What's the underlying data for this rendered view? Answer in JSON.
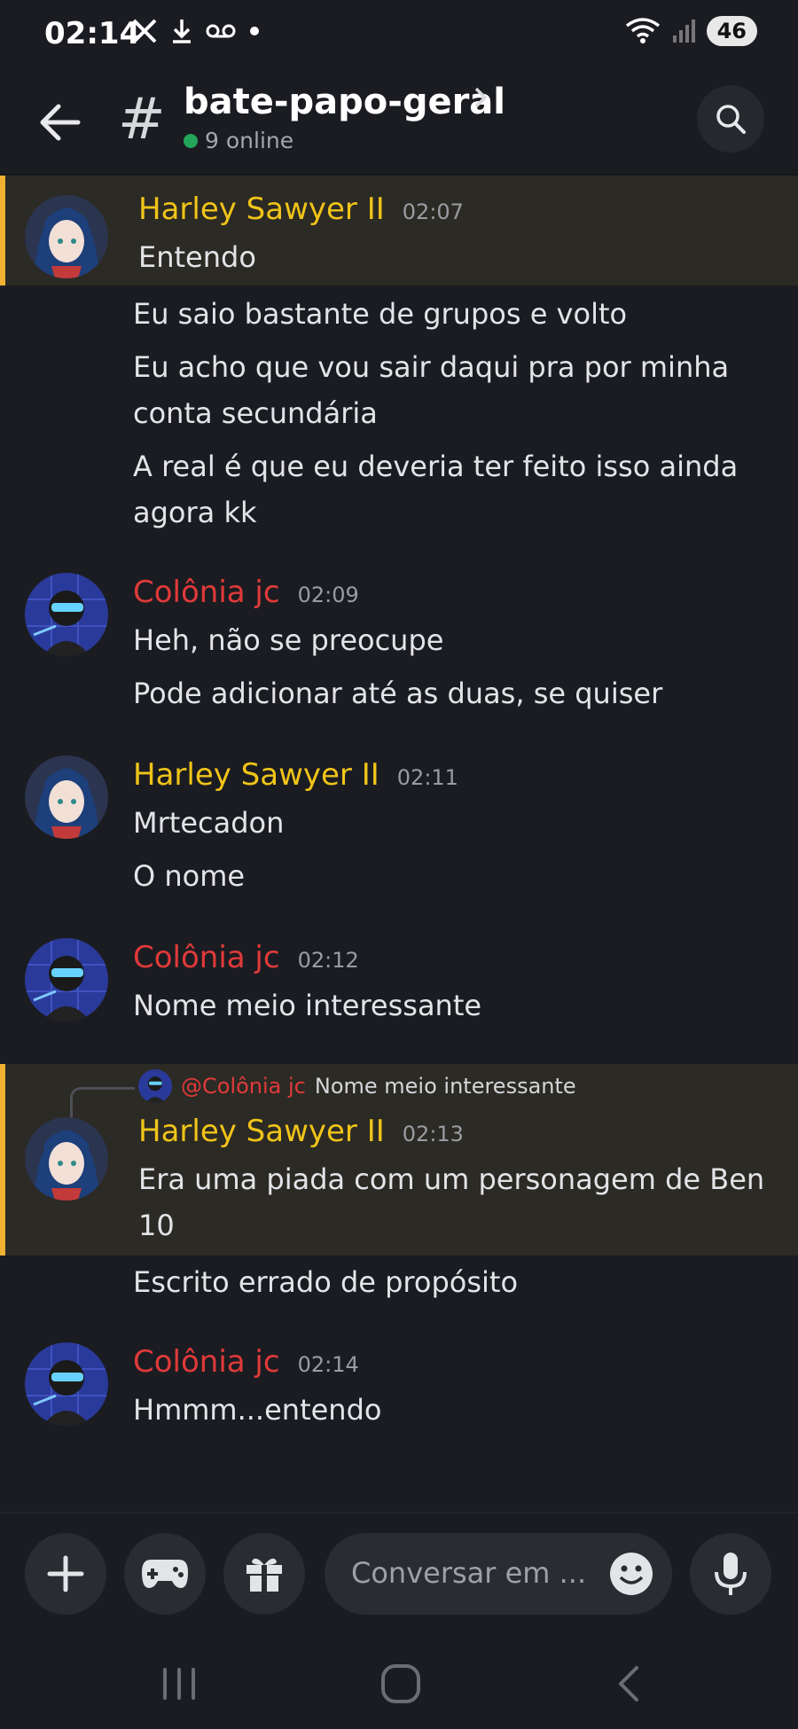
{
  "status_bar": {
    "time": "02:14",
    "battery": "46",
    "icons": [
      "x-logo-icon",
      "download-icon",
      "voicemail-icon",
      "dot-icon",
      "wifi-icon",
      "signal-icon"
    ]
  },
  "header": {
    "channel_prefix": "#",
    "channel_name": "bate-papo-geral",
    "online_text": "9 online",
    "online_color": "#23a55a"
  },
  "messages": [
    {
      "author": "Harley Sawyer II",
      "author_color": "#f0c419",
      "time": "02:07",
      "highlighted": true,
      "lines": [
        "Entendo"
      ]
    },
    {
      "continuation": true,
      "lines": [
        "Eu saio bastante de grupos e volto",
        "Eu acho que vou sair daqui pra por minha conta secundária",
        "A real é que eu deveria ter feito isso ainda agora kk"
      ]
    },
    {
      "author": "Colônia jc",
      "author_color": "#e03a3a",
      "time": "02:09",
      "lines": [
        "Heh, não se preocupe",
        "Pode adicionar até as duas, se quiser"
      ]
    },
    {
      "author": "Harley Sawyer II",
      "author_color": "#f0c419",
      "time": "02:11",
      "lines": [
        "Mrtecadon",
        "O nome"
      ]
    },
    {
      "author": "Colônia jc",
      "author_color": "#e03a3a",
      "time": "02:12",
      "lines": [
        "Nome meio interessante"
      ]
    },
    {
      "author": "Harley Sawyer II",
      "author_color": "#f0c419",
      "time": "02:13",
      "highlighted": true,
      "reply_to": {
        "name": "@Colônia jc",
        "text": "Nome meio interessante"
      },
      "lines": [
        "Era uma piada com um personagem de Ben 10"
      ]
    },
    {
      "continuation": true,
      "lines": [
        "Escrito errado de propósito"
      ]
    },
    {
      "author": "Colônia jc",
      "author_color": "#e03a3a",
      "time": "02:14",
      "lines": [
        "Hmmm...entendo"
      ]
    }
  ],
  "composer": {
    "placeholder": "Conversar em ...",
    "buttons": [
      "plus-icon",
      "gamepad-icon",
      "gift-icon",
      "emoji-icon",
      "microphone-icon"
    ]
  },
  "colors": {
    "background": "#1b1c21",
    "highlight_bg": "#2c2a24",
    "highlight_border": "#f0b132"
  }
}
